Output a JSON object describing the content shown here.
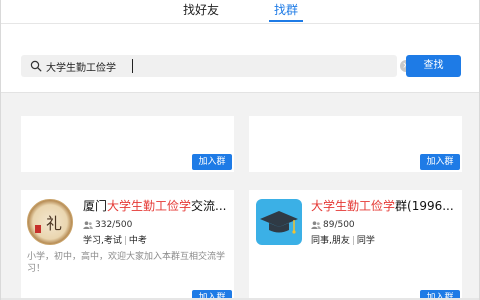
{
  "tabs": {
    "find_friend": "找好友",
    "find_group": "找群"
  },
  "search": {
    "value": "大学生勤工俭学",
    "button_label": "查找",
    "clear_glyph": "×"
  },
  "results": [
    {
      "join_label": "加入群"
    },
    {
      "join_label": "加入群"
    },
    {
      "title_prefix": "厦门",
      "title_highlight": "大学生勤工俭学",
      "title_suffix": "交流...",
      "avatar_glyph": "礼",
      "members": "332/500",
      "tags": [
        "学习,考试",
        "中考"
      ],
      "description": "小学，初中，高中，欢迎大家加入本群互相交流学习！",
      "join_label": "加入群"
    },
    {
      "title_prefix": "",
      "title_highlight": "大学生勤工俭学",
      "title_suffix": "群(1996...",
      "members": "89/500",
      "tags": [
        "同事,朋友",
        "同学"
      ],
      "join_label": "加入群"
    }
  ],
  "icons": {
    "search": "search-icon",
    "clear": "clear-icon",
    "people": "people-icon",
    "graduation_cap": "graduation-cap-icon"
  },
  "colors": {
    "accent": "#1e7be6",
    "highlight": "#e53935"
  }
}
